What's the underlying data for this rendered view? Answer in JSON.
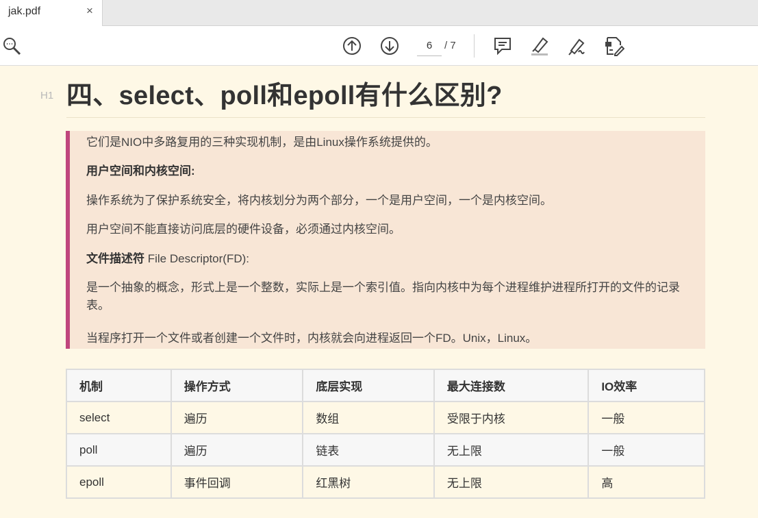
{
  "tab": {
    "title": "jak.pdf",
    "close": "×"
  },
  "toolbar": {
    "page_current": "6",
    "page_total": "/ 7"
  },
  "doc": {
    "heading_marker": "H1",
    "title": "四、select、poll和epoll有什么区别?",
    "quote": {
      "p1": "它们是NIO中多路复用的三种实现机制，是由Linux操作系统提供的。",
      "h_user_kernel": "用户空间和内核空间:",
      "p2": "操作系统为了保护系统安全，将内核划分为两个部分，一个是用户空间，一个是内核空间。",
      "p3": "用户空间不能直接访问底层的硬件设备，必须通过内核空间。",
      "h_fd_bold": "文件描述符",
      "h_fd_rest": " File Descriptor(FD):",
      "p4": "是一个抽象的概念，形式上是一个整数，实际上是一个索引值。指向内核中为每个进程维护进程所打开的文件的记录表。",
      "p5": "当程序打开一个文件或者创建一个文件时，内核就会向进程返回一个FD。Unix，Linux。"
    },
    "table": {
      "headers": [
        "机制",
        "操作方式",
        "底层实现",
        "最大连接数",
        "IO效率"
      ],
      "rows": [
        [
          "select",
          "遍历",
          "数组",
          "受限于内核",
          "一般"
        ],
        [
          "poll",
          "遍历",
          "链表",
          "无上限",
          "一般"
        ],
        [
          "epoll",
          "事件回调",
          "红黑树",
          "无上限",
          "高"
        ]
      ]
    }
  }
}
